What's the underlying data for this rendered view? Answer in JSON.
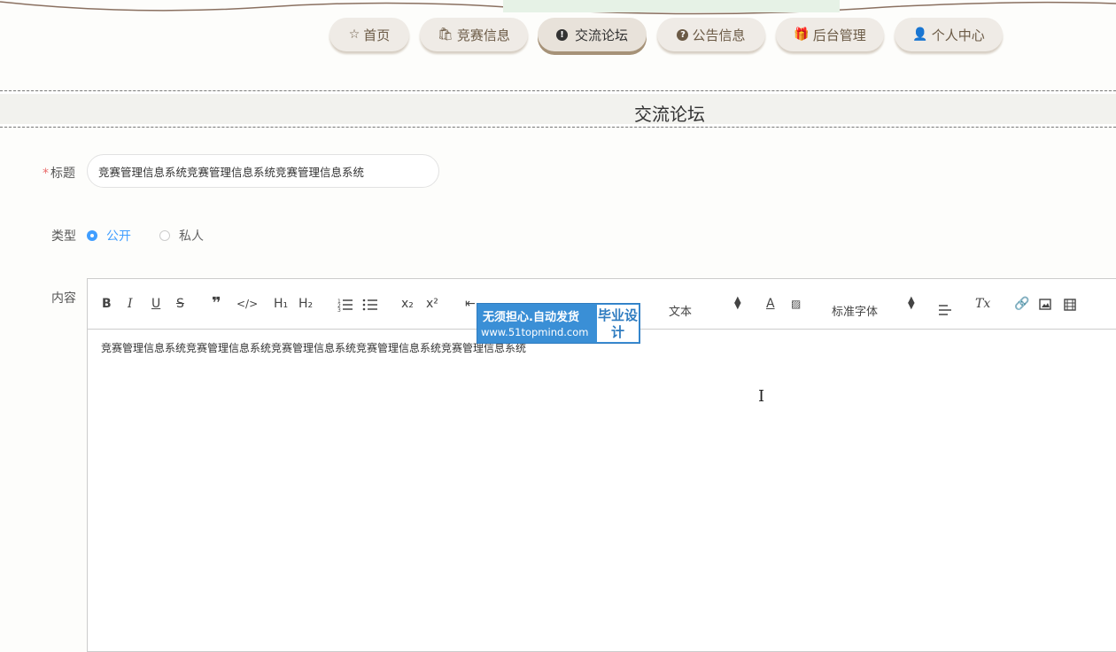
{
  "nav": {
    "items": [
      {
        "label": "首页",
        "icon": "star-icon"
      },
      {
        "label": "竞赛信息",
        "icon": "bag-icon"
      },
      {
        "label": "交流论坛",
        "icon": "exclamation-circle-icon",
        "active": true
      },
      {
        "label": "公告信息",
        "icon": "question-circle-icon"
      },
      {
        "label": "后台管理",
        "icon": "gift-icon"
      },
      {
        "label": "个人中心",
        "icon": "user-icon"
      }
    ]
  },
  "page": {
    "title": "交流论坛"
  },
  "form": {
    "title_label": "标题",
    "title_required_mark": "*",
    "title_value": "竞赛管理信息系统竞赛管理信息系统竞赛管理信息系统",
    "type_label": "类型",
    "type_options": [
      {
        "label": "公开",
        "selected": true
      },
      {
        "label": "私人",
        "selected": false
      }
    ],
    "content_label": "内容"
  },
  "editor": {
    "toolbar": {
      "bold": "B",
      "italic": "I",
      "underline": "U",
      "strike": "S",
      "blockquote": "❞",
      "code": "</>",
      "h1": "H₁",
      "h2": "H₂",
      "ordered_list": "ordered-list-icon",
      "bullet_list": "bullet-list-icon",
      "subscript": "x₂",
      "superscript": "x²",
      "indent_label": "⇤",
      "size_picker": "文本",
      "font_picker": "标准字体",
      "clean": "Tx"
    },
    "content": "竞赛管理信息系统竞赛管理信息系统竞赛管理信息系统竞赛管理信息系统竞赛管理信息系统"
  },
  "watermark": {
    "line1": "无须担心.自动发货",
    "line2": "www.51topmind.com",
    "right": "毕业设计"
  },
  "colors": {
    "accent": "#409eff",
    "nav_text": "#6b5a45",
    "watermark": "#3a8fd6"
  }
}
